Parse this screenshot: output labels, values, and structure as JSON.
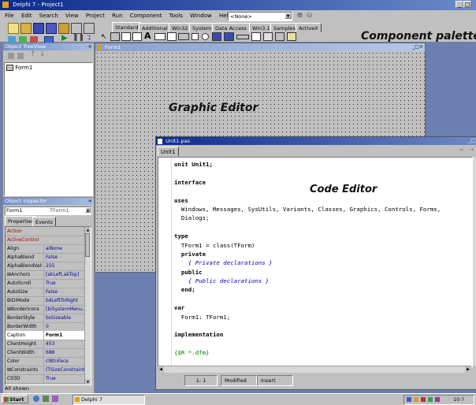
{
  "main_window": {
    "title": "Delphi 7 - Project1",
    "menu": [
      "File",
      "Edit",
      "Search",
      "View",
      "Project",
      "Run",
      "Component",
      "Tools",
      "Window",
      "Help"
    ],
    "desktop_combo_value": "<None>"
  },
  "palette": {
    "tabs": [
      "Standard",
      "Additional",
      "Win32",
      "System",
      "Data Access",
      "Win3.1",
      "Samples",
      "ActiveX"
    ]
  },
  "annotations": {
    "component_palette": "Component palette",
    "graphic_editor": "Graphic Editor",
    "code_editor": "Code Editor"
  },
  "object_treeview": {
    "title": "Object TreeView",
    "items": [
      "Form1"
    ]
  },
  "object_inspector": {
    "title": "Object Inspector",
    "selected_object": "Form1",
    "selected_type": "TForm1",
    "tabs": [
      "Properties",
      "Events"
    ],
    "properties": [
      {
        "name": "Action",
        "value": ""
      },
      {
        "name": "ActiveControl",
        "value": ""
      },
      {
        "name": "Align",
        "value": "alNone"
      },
      {
        "name": "AlphaBlend",
        "value": "False"
      },
      {
        "name": "AlphaBlendValue",
        "value": "255"
      },
      {
        "name": "⊞Anchors",
        "value": "[akLeft,akTop]"
      },
      {
        "name": "AutoScroll",
        "value": "True"
      },
      {
        "name": "AutoSize",
        "value": "False"
      },
      {
        "name": "BiDiMode",
        "value": "bdLeftToRight"
      },
      {
        "name": "⊞BorderIcons",
        "value": "[biSystemMenu,"
      },
      {
        "name": "BorderStyle",
        "value": "bsSizeable"
      },
      {
        "name": "BorderWidth",
        "value": "0"
      },
      {
        "name": "Caption",
        "value": "Form1"
      },
      {
        "name": "ClientHeight",
        "value": "453"
      },
      {
        "name": "ClientWidth",
        "value": "688"
      },
      {
        "name": "Color",
        "value": "clBtnFace"
      },
      {
        "name": "⊞Constraints",
        "value": "(TSizeConstraint"
      },
      {
        "name": "Ctl3D",
        "value": "True"
      }
    ],
    "status": "All shown"
  },
  "form_designer": {
    "title": "Form1"
  },
  "code_editor": {
    "title": "Unit1.pas",
    "tab": "Unit1",
    "lines": [
      {
        "text": "unit Unit1;",
        "style": "bold"
      },
      {
        "text": "",
        "style": "normal"
      },
      {
        "text": "interface",
        "style": "bold"
      },
      {
        "text": "",
        "style": "normal"
      },
      {
        "text": "uses",
        "style": "bold"
      },
      {
        "text": "  Windows, Messages, SysUtils, Variants, Classes, Graphics, Controls, Forms,",
        "style": "normal"
      },
      {
        "text": "  Dialogs;",
        "style": "normal"
      },
      {
        "text": "",
        "style": "normal"
      },
      {
        "text": "type",
        "style": "bold"
      },
      {
        "text": "  TForm1 = class(TForm)",
        "style": "normal"
      },
      {
        "text": "  private",
        "style": "bold"
      },
      {
        "text": "    { Private declarations }",
        "style": "comment"
      },
      {
        "text": "  public",
        "style": "bold"
      },
      {
        "text": "    { Public declarations }",
        "style": "comment"
      },
      {
        "text": "  end;",
        "style": "bold"
      },
      {
        "text": "",
        "style": "normal"
      },
      {
        "text": "var",
        "style": "bold"
      },
      {
        "text": "  Form1: TForm1;",
        "style": "normal"
      },
      {
        "text": "",
        "style": "normal"
      },
      {
        "text": "implementation",
        "style": "bold"
      },
      {
        "text": "",
        "style": "normal"
      },
      {
        "text": "{$R *.dfm}",
        "style": "directive"
      }
    ],
    "status": {
      "position": "1: 1",
      "modified": "Modified",
      "mode": "Insert"
    }
  },
  "taskbar": {
    "start": "Start",
    "task": "Delphi 7",
    "clock": "10:?"
  },
  "colors": {
    "title_active": "#0b2a8c",
    "desktop": "#6d7fb1",
    "comment": "#0000c0",
    "directive": "#008000"
  }
}
